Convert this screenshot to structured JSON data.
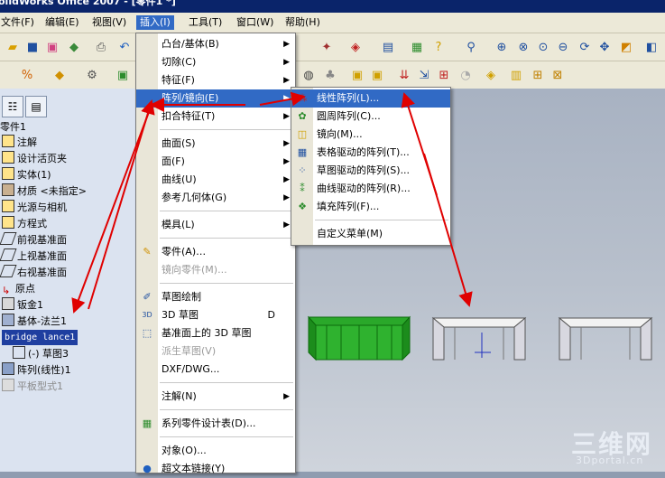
{
  "window": {
    "title": "olidWorks Office 2007 - [零件1 *]"
  },
  "menubar": {
    "items": [
      {
        "label": "文件(F)"
      },
      {
        "label": "编辑(E)"
      },
      {
        "label": "视图(V)"
      },
      {
        "label": "插入(I)"
      },
      {
        "label": "工具(T)"
      },
      {
        "label": "窗口(W)"
      },
      {
        "label": "帮助(H)"
      }
    ]
  },
  "tree": {
    "nodes": [
      {
        "label": "零件1"
      },
      {
        "label": "注解"
      },
      {
        "label": "设计活页夹"
      },
      {
        "label": "实体(1)"
      },
      {
        "label": "材质 <未指定>"
      },
      {
        "label": "光源与相机"
      },
      {
        "label": "方程式"
      },
      {
        "label": "前视基准面"
      },
      {
        "label": "上视基准面"
      },
      {
        "label": "右视基准面"
      },
      {
        "label": "原点"
      },
      {
        "label": "钣金1"
      },
      {
        "label": "基体-法兰1"
      },
      {
        "label": "bridge lance1"
      },
      {
        "label": "(-) 草图3"
      },
      {
        "label": "阵列(线性)1"
      },
      {
        "label": "平板型式1"
      }
    ]
  },
  "insert_menu": {
    "items": [
      {
        "label": "凸台/基体(B)"
      },
      {
        "label": "切除(C)"
      },
      {
        "label": "特征(F)"
      },
      {
        "label": "阵列/镜向(E)"
      },
      {
        "label": "扣合特征(T)"
      },
      {
        "label": "曲面(S)"
      },
      {
        "label": "面(F)"
      },
      {
        "label": "曲线(U)"
      },
      {
        "label": "参考几何体(G)"
      },
      {
        "label": "模具(L)"
      },
      {
        "label": "零件(A)…"
      },
      {
        "label": "镜向零件(M)..."
      },
      {
        "label": "草图绘制"
      },
      {
        "label": "3D 草图"
      },
      {
        "label": "基准面上的 3D 草图"
      },
      {
        "label": "派生草图(V)"
      },
      {
        "label": "DXF/DWG..."
      },
      {
        "label": "注解(N)"
      },
      {
        "label": "系列零件设计表(D)..."
      },
      {
        "label": "对象(O)..."
      },
      {
        "label": "超文本链接(Y)"
      }
    ],
    "shortcut_3d_sketch": "D"
  },
  "pattern_submenu": {
    "items": [
      {
        "label": "线性阵列(L)..."
      },
      {
        "label": "圆周阵列(C)..."
      },
      {
        "label": "镜向(M)..."
      },
      {
        "label": "表格驱动的阵列(T)..."
      },
      {
        "label": "草图驱动的阵列(S)..."
      },
      {
        "label": "曲线驱动的阵列(R)..."
      },
      {
        "label": "填充阵列(F)..."
      },
      {
        "label": "自定义菜单(M)"
      }
    ]
  },
  "watermark": {
    "line1": "三维网",
    "line2": "3Dportal.cn"
  },
  "colors": {
    "menu_highlight": "#316ac5",
    "titlebar": "#0a246a",
    "arrow": "#e00000",
    "part_selected": "#1ea41e"
  }
}
